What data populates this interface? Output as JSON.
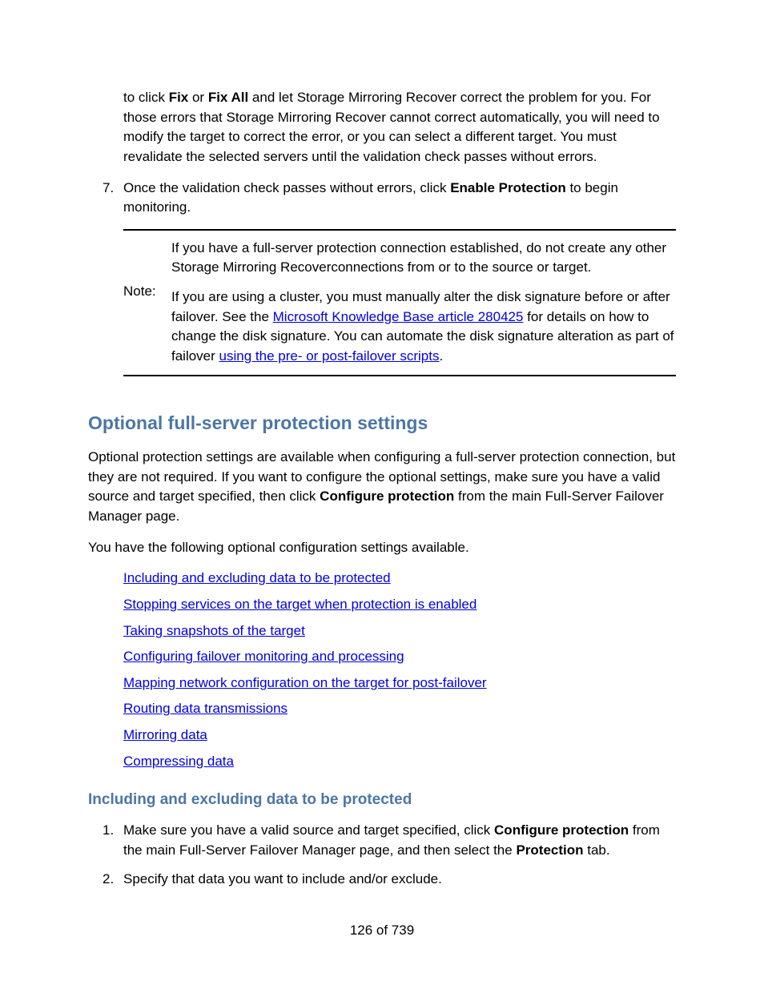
{
  "list_continued": {
    "item6_part": {
      "pre": "to click ",
      "b1": "Fix",
      "mid1": " or ",
      "b2": "Fix All",
      "rest": " and let Storage Mirroring Recover correct the problem for you. For those errors that Storage Mirroring Recover cannot correct automatically, you will need to modify the target to correct the error, or you can select a different target. You must revalidate the selected servers until the validation check passes without errors."
    },
    "item7": {
      "marker": "7.",
      "pre": "Once the validation check passes without errors, click ",
      "b1": "Enable Protection",
      "rest": " to begin monitoring."
    }
  },
  "note": {
    "label": "Note:",
    "para1": "If you have a full-server protection connection established, do not create any other Storage Mirroring Recoverconnections from or to the source or target.",
    "para2_pre": "If you are using a cluster, you must manually alter the disk signature before or after failover. See the ",
    "para2_link1": "Microsoft Knowledge Base article 280425",
    "para2_mid": "  for details on how to change the disk signature. You can automate the disk signature alteration as part of failover ",
    "para2_link2": "using the pre- or post-failover scripts",
    "para2_end": "."
  },
  "section": {
    "title": "Optional full-server protection settings",
    "para1_pre": "Optional protection settings are available when configuring a full-server protection connection, but they are not required. If you want to configure the optional settings, make sure you have a valid source and target specified, then click ",
    "para1_b": "Configure protection",
    "para1_post": " from the main Full-Server Failover Manager page.",
    "para2": "You have the following optional configuration settings available.",
    "links": [
      "Including and excluding data to be protected",
      "Stopping services on the target when protection is enabled",
      "Taking snapshots of the target",
      "Configuring failover monitoring and processing",
      "Mapping network configuration on the target for post-failover",
      "Routing data transmissions",
      "Mirroring data",
      "Compressing data"
    ]
  },
  "subsection": {
    "title": "Including and excluding data to be protected",
    "items": [
      {
        "marker": "1.",
        "pre": "Make sure you have a valid source and target specified, click ",
        "b1": "Configure protection",
        "mid": " from the main Full-Server Failover Manager page, and then select the ",
        "b2": "Protection",
        "post": " tab."
      },
      {
        "marker": "2.",
        "text": "Specify that data you want to include and/or exclude."
      }
    ]
  },
  "footer": "126 of 739"
}
